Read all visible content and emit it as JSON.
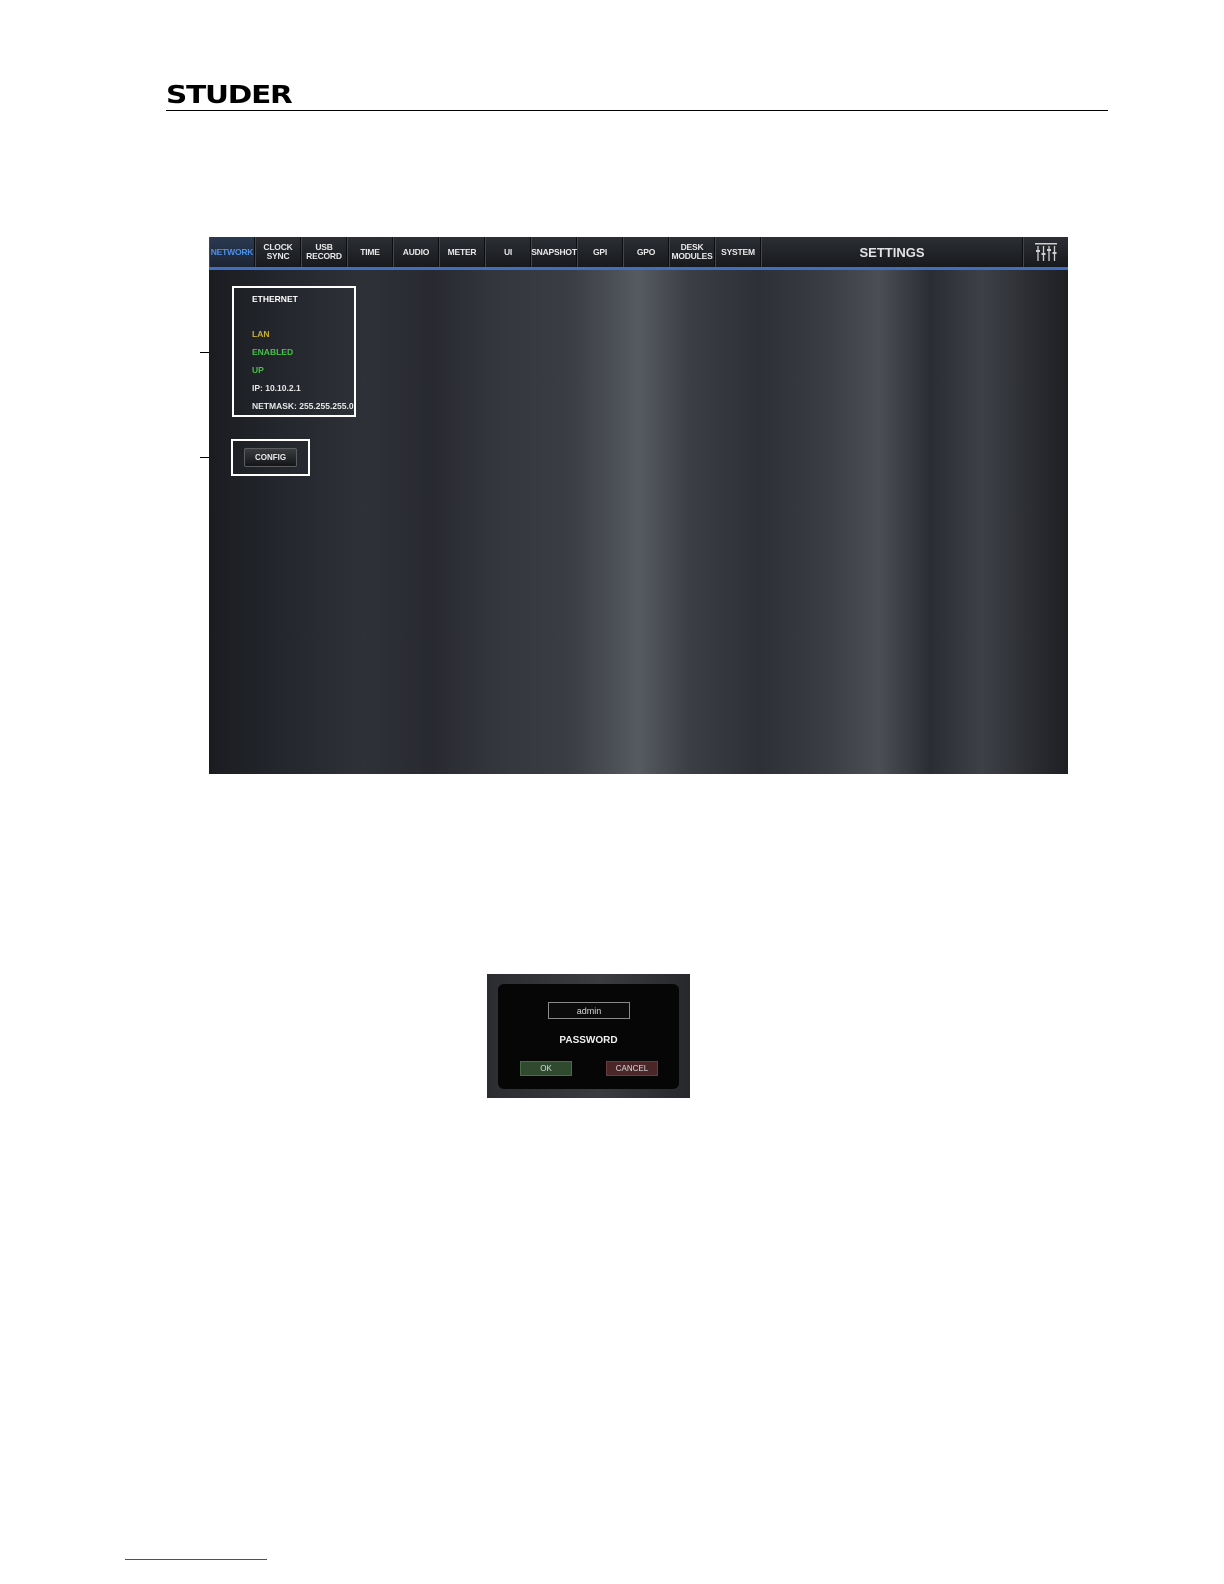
{
  "document": {
    "logo_text": "STUDER"
  },
  "tabbar": {
    "tabs": [
      {
        "label": "NETWORK",
        "active": true
      },
      {
        "label": "CLOCK\nSYNC",
        "active": false
      },
      {
        "label": "USB\nRECORD",
        "active": false
      },
      {
        "label": "TIME",
        "active": false
      },
      {
        "label": "AUDIO",
        "active": false
      },
      {
        "label": "METER",
        "active": false
      },
      {
        "label": "UI",
        "active": false
      },
      {
        "label": "SNAPSHOT",
        "active": false
      },
      {
        "label": "GPI",
        "active": false
      },
      {
        "label": "GPO",
        "active": false
      },
      {
        "label": "DESK\nMODULES",
        "active": false
      },
      {
        "label": "SYSTEM",
        "active": false
      }
    ],
    "title": "SETTINGS",
    "mixer_icon": "mixer-faders-icon"
  },
  "ethernet": {
    "title": "ETHERNET",
    "interface": "LAN",
    "state": "ENABLED",
    "link": "UP",
    "ip": "IP: 10.10.2.1",
    "netmask": "NETMASK: 255.255.255.0",
    "colors": {
      "lan": "#c9b13a",
      "status_ok": "#46c24a",
      "accent": "#3e6fc0"
    }
  },
  "config": {
    "button_label": "CONFIG"
  },
  "password_dialog": {
    "input_value": "admin",
    "label": "PASSWORD",
    "ok_label": "OK",
    "cancel_label": "CANCEL"
  }
}
